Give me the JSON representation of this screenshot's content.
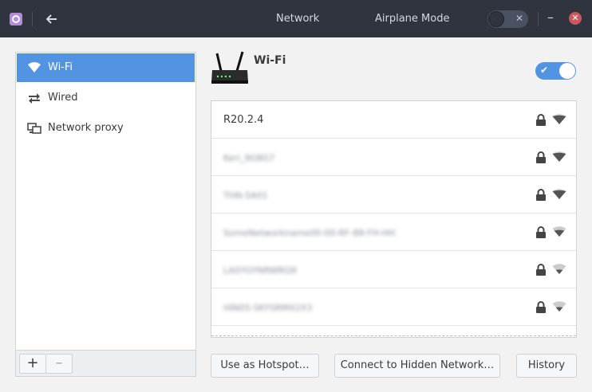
{
  "header": {
    "title": "Network",
    "airplane_label": "Airplane Mode",
    "airplane_on": false,
    "minimize_glyph": "–",
    "close_glyph": "✕"
  },
  "sidebar": {
    "items": [
      {
        "label": "Wi-Fi",
        "icon": "wifi-icon",
        "active": true
      },
      {
        "label": "Wired",
        "icon": "wired-icon",
        "active": false
      },
      {
        "label": "Network proxy",
        "icon": "proxy-icon",
        "active": false
      }
    ],
    "add_glyph": "+",
    "remove_glyph": "–"
  },
  "main": {
    "title": "Wi-Fi",
    "wifi_enabled": true,
    "networks": [
      {
        "ssid": "R20.2.4",
        "blurred": false,
        "secured": true,
        "strength": 1.0
      },
      {
        "ssid": "Keri_9G8G7",
        "blurred": true,
        "secured": true,
        "strength": 1.0
      },
      {
        "ssid": "THN-5A01",
        "blurred": true,
        "secured": true,
        "strength": 1.0
      },
      {
        "ssid": "SomeNetworkname00-00-RF-88-FH-HH",
        "blurred": true,
        "secured": true,
        "strength": 0.75
      },
      {
        "ssid": "LASYGYNRWRQ9",
        "blurred": true,
        "secured": true,
        "strength": 0.5
      },
      {
        "ssid": "HIN05-SKYSRMX2X3",
        "blurred": true,
        "secured": true,
        "strength": 0.5
      }
    ],
    "buttons": {
      "hotspot": "Use as Hotspot…",
      "hidden": "Connect to Hidden Network…",
      "history": "History"
    }
  },
  "colors": {
    "accent": "#5294e2",
    "header_bg": "#2f343f",
    "close": "#cc575d"
  }
}
